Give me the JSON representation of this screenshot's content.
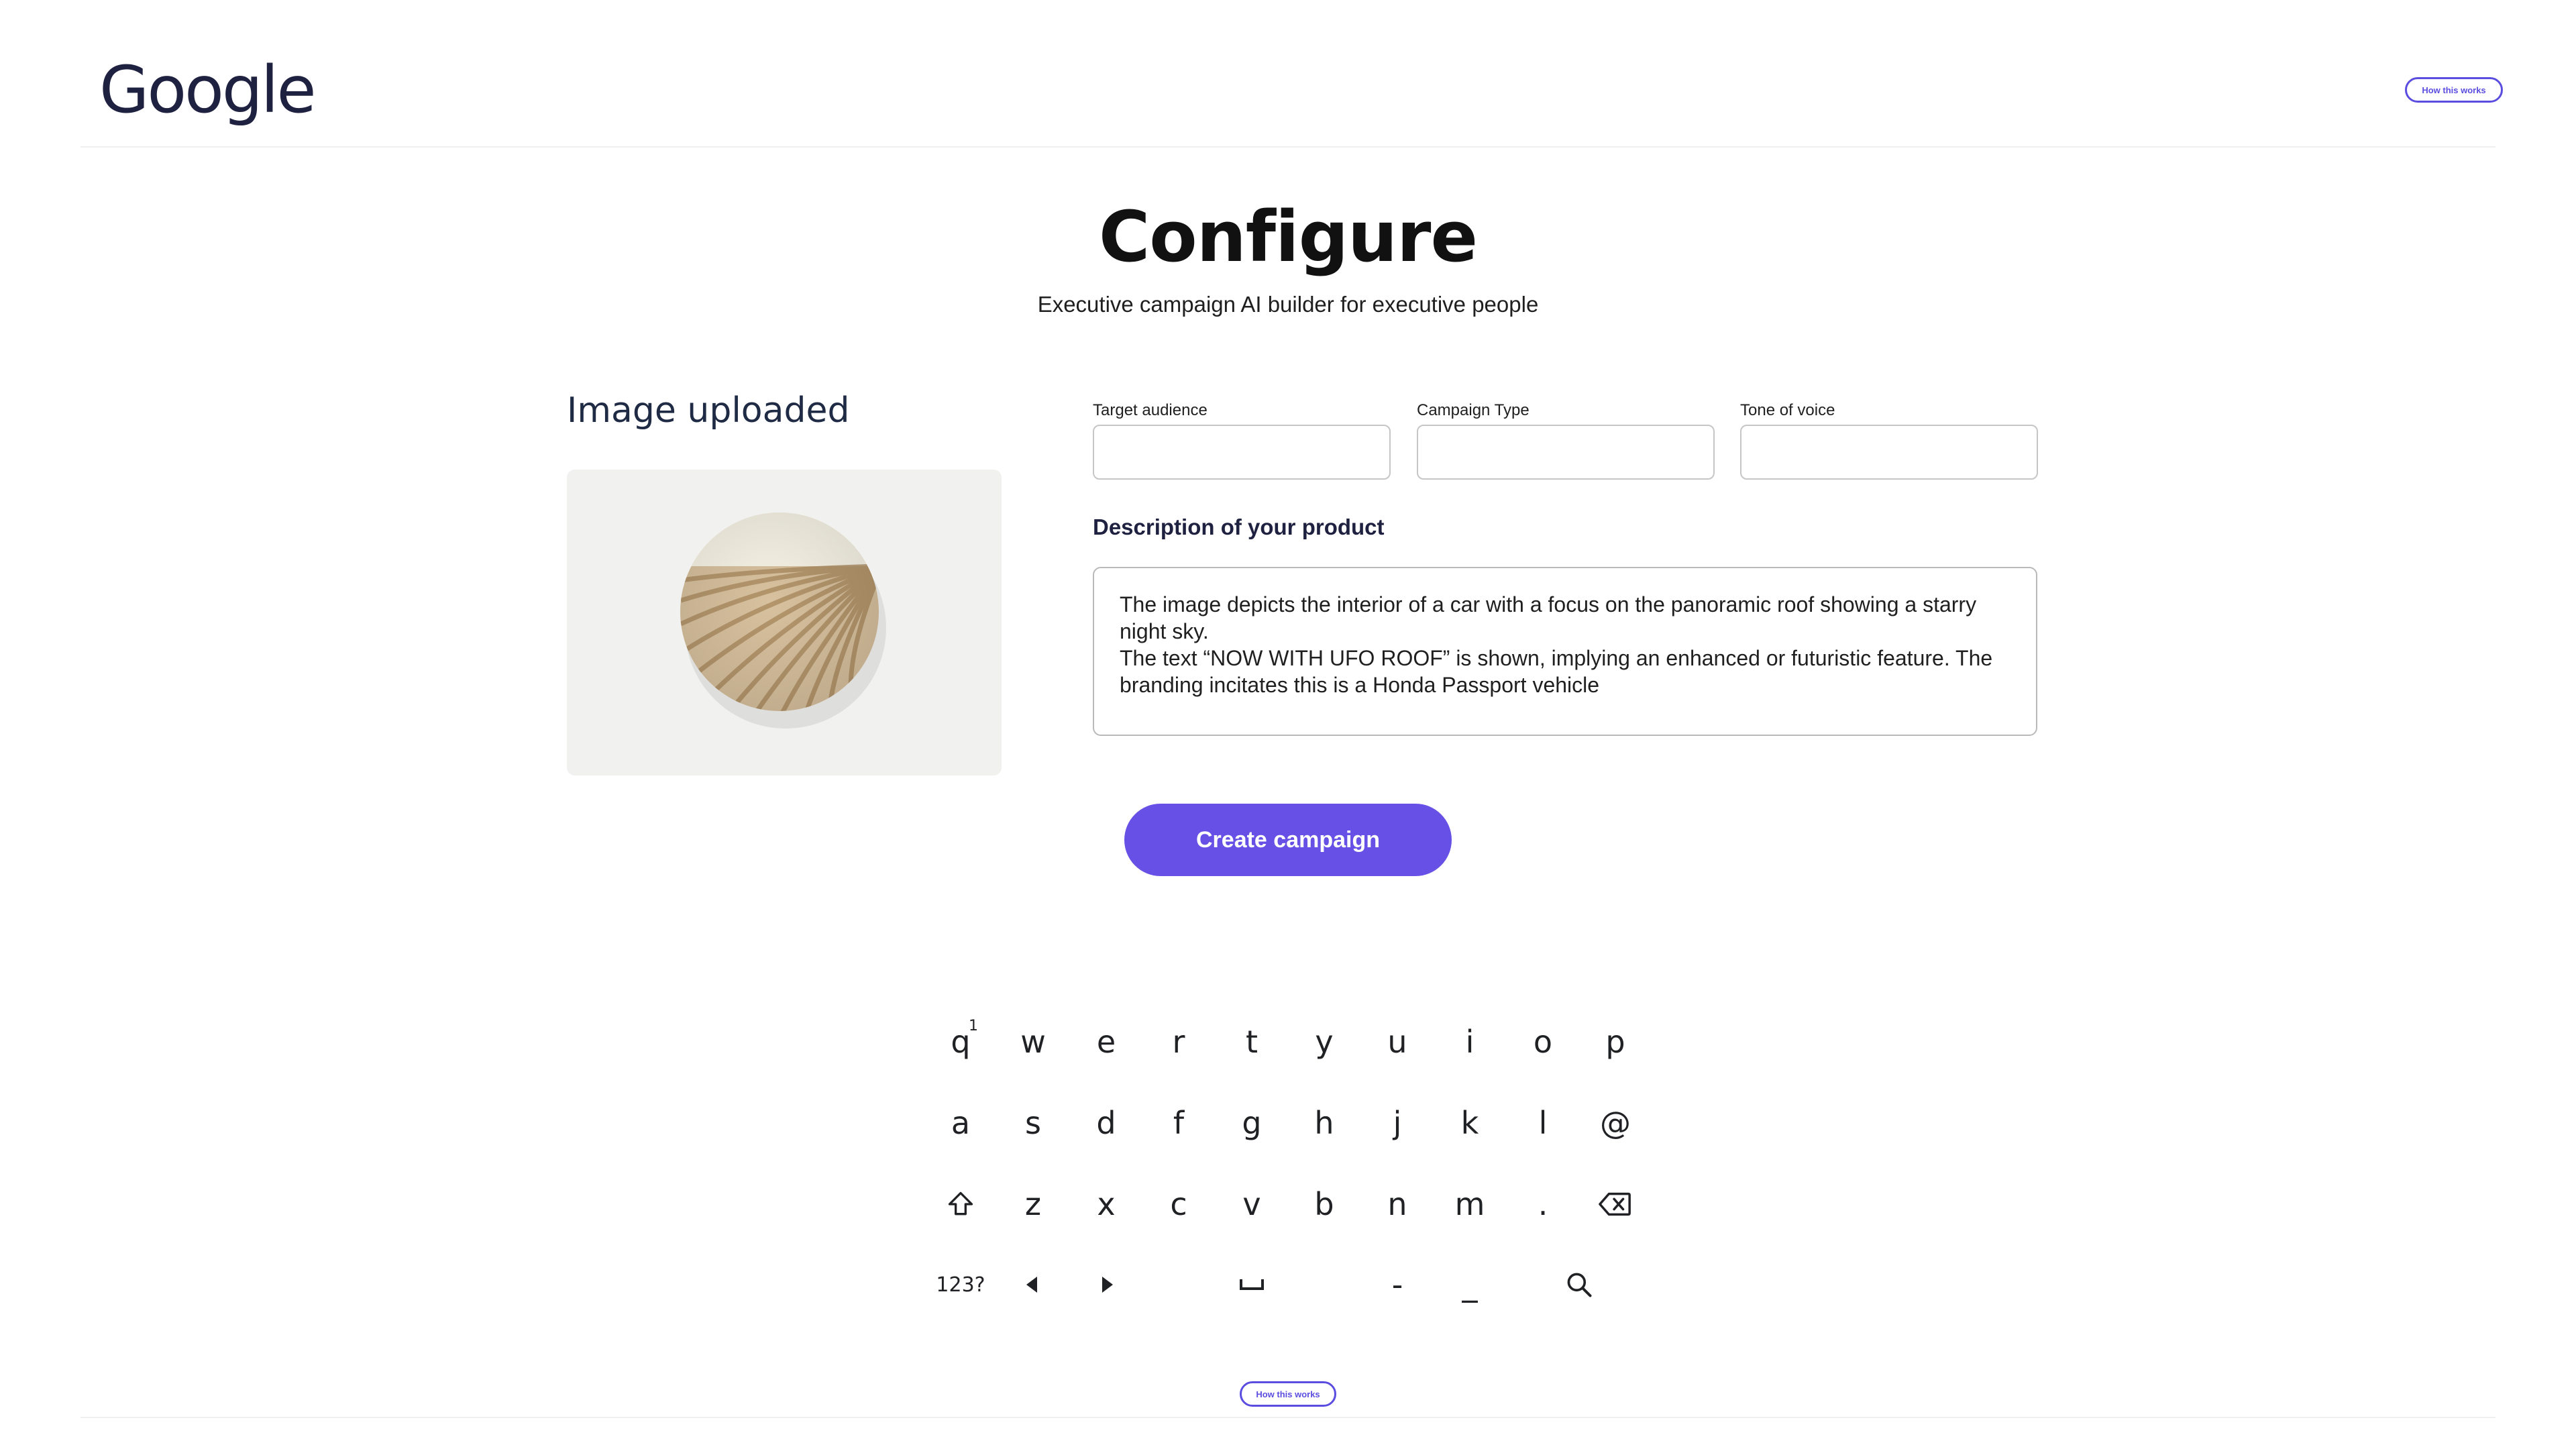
{
  "header": {
    "logo_text": "Google",
    "how_it_works_label": "How this works"
  },
  "page": {
    "title": "Configure",
    "subtitle": "Executive campaign AI builder for executive people"
  },
  "image_panel": {
    "heading": "Image uploaded"
  },
  "form": {
    "target_audience": {
      "label": "Target audience",
      "value": ""
    },
    "campaign_type": {
      "label": "Campaign Type",
      "value": ""
    },
    "tone_of_voice": {
      "label": "Tone of voice",
      "value": ""
    },
    "description": {
      "label": "Description of your product",
      "value": "The image depicts the interior of a car with a focus on the panoramic roof showing a starry\nnight sky.\nThe text “NOW WITH UFO ROOF” is shown, implying an enhanced or futuristic feature. The\nbranding incitates this is a Honda Passport vehicle"
    },
    "submit_label": "Create campaign"
  },
  "keyboard": {
    "row1": [
      "q",
      "w",
      "e",
      "r",
      "t",
      "y",
      "u",
      "i",
      "o",
      "p"
    ],
    "row1_hint": "1",
    "row2": [
      "a",
      "s",
      "d",
      "f",
      "g",
      "h",
      "j",
      "k",
      "l",
      "@"
    ],
    "row3": [
      "z",
      "x",
      "c",
      "v",
      "b",
      "n",
      "m",
      "."
    ],
    "row4": {
      "symbols": "123?",
      "dash": "-",
      "underscore": "_"
    },
    "icons": [
      "shift-icon",
      "backspace-icon",
      "arrow-left-icon",
      "arrow-right-icon",
      "space-icon",
      "search-icon"
    ]
  },
  "footer": {
    "how_it_works_label": "How this works"
  },
  "colors": {
    "accent": "#6650e6",
    "logo": "#1f2140",
    "divider": "#f0f0f0"
  }
}
